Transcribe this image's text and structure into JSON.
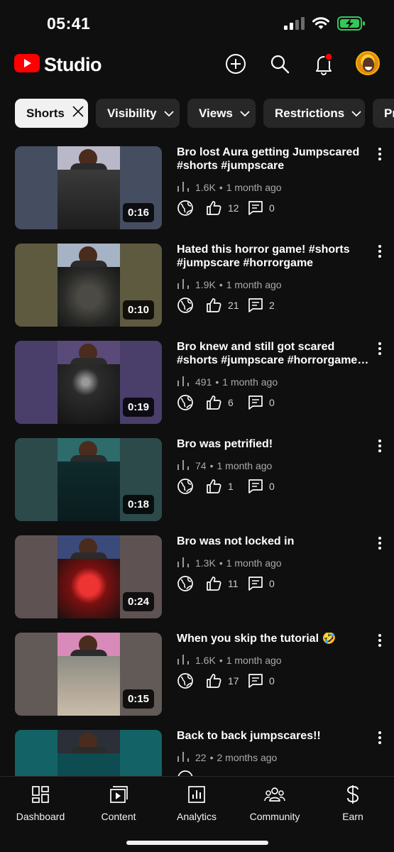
{
  "status_bar": {
    "time": "05:41"
  },
  "app": {
    "logo_text": "Studio",
    "brand_color": "#ff0000"
  },
  "header": {
    "icons": [
      "create-icon",
      "search-icon",
      "notifications-icon",
      "avatar"
    ]
  },
  "filters": [
    {
      "label": "Shorts",
      "active": true
    },
    {
      "label": "Visibility"
    },
    {
      "label": "Views"
    },
    {
      "label": "Restrictions"
    },
    {
      "label": "Pr"
    }
  ],
  "videos": [
    {
      "title": "Bro lost Aura getting Jumpscared #shorts #jumpscare",
      "views": "1.6K",
      "age": "1 month ago",
      "likes": "12",
      "comments": "0",
      "duration": "0:16",
      "visibility": "public",
      "bg": "#454e60"
    },
    {
      "title": "Hated this horror game! #shorts #jumpscare #horrorgame",
      "views": "1.9K",
      "age": "1 month ago",
      "likes": "21",
      "comments": "2",
      "duration": "0:10",
      "visibility": "public",
      "bg": "#5d5a40"
    },
    {
      "title": "Bro knew and still got scared #shorts #jumpscare #horrorgame #gaming",
      "views": "491",
      "age": "1 month ago",
      "likes": "6",
      "comments": "0",
      "duration": "0:19",
      "visibility": "public",
      "bg": "#4a3f6b"
    },
    {
      "title": "Bro was petrified!",
      "views": "74",
      "age": "1 month ago",
      "likes": "1",
      "comments": "0",
      "duration": "0:18",
      "visibility": "public",
      "bg": "#2c4a4a"
    },
    {
      "title": "Bro was not locked in",
      "views": "1.3K",
      "age": "1 month ago",
      "likes": "11",
      "comments": "0",
      "duration": "0:24",
      "visibility": "public",
      "bg": "#5e5252"
    },
    {
      "title": "When you skip the tutorial 🤣",
      "views": "1.6K",
      "age": "1 month ago",
      "likes": "17",
      "comments": "0",
      "duration": "0:15",
      "visibility": "public",
      "bg": "#615a56"
    },
    {
      "title": "Back to back jumpscares!!",
      "views": "22",
      "age": "2 months ago",
      "likes": "",
      "comments": "",
      "duration": "",
      "visibility": "public",
      "bg": "#136366"
    }
  ],
  "bottom_nav": [
    {
      "label": "Dashboard",
      "icon": "dashboard-icon"
    },
    {
      "label": "Content",
      "icon": "content-icon"
    },
    {
      "label": "Analytics",
      "icon": "analytics-icon"
    },
    {
      "label": "Community",
      "icon": "community-icon"
    },
    {
      "label": "Earn",
      "icon": "earn-icon"
    }
  ]
}
